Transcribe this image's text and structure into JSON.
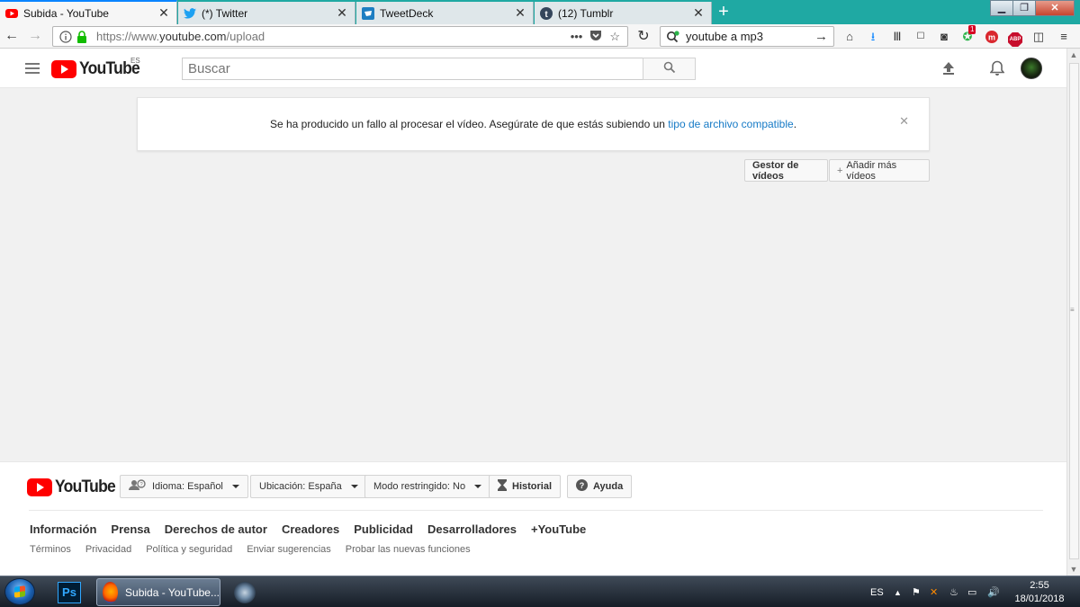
{
  "browser": {
    "tabs": [
      {
        "label": "Subida - YouTube",
        "active": true,
        "icon": "youtube-icon"
      },
      {
        "label": "(*) Twitter",
        "active": false,
        "icon": "twitter-icon"
      },
      {
        "label": "TweetDeck",
        "active": false,
        "icon": "tweetdeck-icon"
      },
      {
        "label": "(12) Tumblr",
        "active": false,
        "icon": "tumblr-icon"
      }
    ],
    "new_tab": "+",
    "url": {
      "prefix": "https://www.",
      "host": "youtube.com",
      "path": "/upload"
    },
    "search_value": "youtube a mp3",
    "badge_count": "1",
    "abp_label": "ABP"
  },
  "youtube": {
    "logo_text": "YouTube",
    "country_code": "ES",
    "search_placeholder": "Buscar",
    "alert": {
      "message": "Se ha producido un fallo al procesar el vídeo. Asegúrate de que estás subiendo un ",
      "link": "tipo de archivo compatible",
      "end": "."
    },
    "buttons": {
      "video_manager": "Gestor de vídeos",
      "add_more": "Añadir más vídeos"
    }
  },
  "footer": {
    "logo_text": "YouTube",
    "language": "Idioma: Español",
    "location": "Ubicación: España",
    "restricted": "Modo restringido: No",
    "history": "Historial",
    "help": "Ayuda",
    "links_primary": [
      "Información",
      "Prensa",
      "Derechos de autor",
      "Creadores",
      "Publicidad",
      "Desarrolladores",
      "+YouTube"
    ],
    "links_secondary": [
      "Términos",
      "Privacidad",
      "Política y seguridad",
      "Enviar sugerencias",
      "Probar las nuevas funciones"
    ]
  },
  "taskbar": {
    "ps_label": "Ps",
    "firefox_task": "Subida - YouTube...",
    "lang": "ES",
    "time": "2:55",
    "date": "18/01/2018"
  },
  "colors": {
    "youtube_red": "#ff0000",
    "link_blue": "#167ac6",
    "tabstrip_teal": "#1fa9a3",
    "page_bg": "#f1f1f1"
  }
}
